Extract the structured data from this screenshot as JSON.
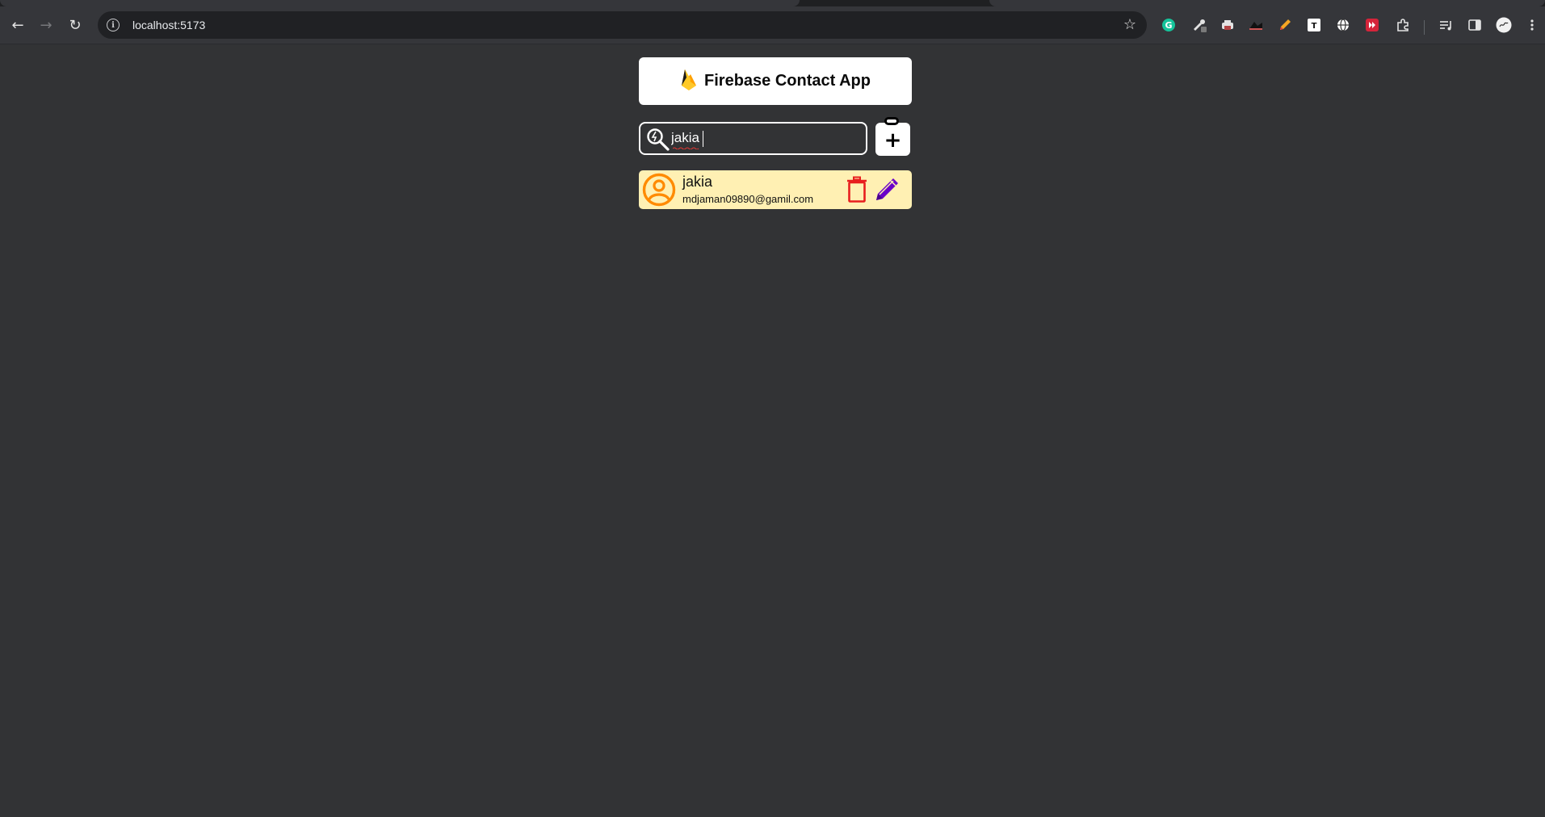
{
  "browser": {
    "url": "localhost:5173",
    "back_icon": "arrow-left-icon",
    "forward_icon": "arrow-right-icon",
    "reload_icon": "reload-icon",
    "extensions": [
      "grammarly-icon",
      "dropper-icon",
      "printer-icon",
      "extension-dark-icon",
      "pencil-ext-icon",
      "text-ext-icon",
      "globe-ext-icon",
      "red-ext-icon",
      "puzzle-icon",
      "media-icon",
      "sidebar-icon",
      "profile-icon"
    ]
  },
  "app": {
    "title": "Firebase Contact App",
    "search": {
      "value": "jakia",
      "placeholder": ""
    },
    "add_button_label": "+",
    "contacts": [
      {
        "name": "jakia",
        "email": "mdjaman09890@gamil.com"
      }
    ]
  },
  "colors": {
    "page_bg": "#323335",
    "card_bg": "#fff0b3",
    "avatar": "#ff8a00",
    "trash": "#e81e1e",
    "edit": "#6a00c8",
    "flame_yellow": "#ffc82c",
    "flame_orange": "#ff9a00"
  }
}
